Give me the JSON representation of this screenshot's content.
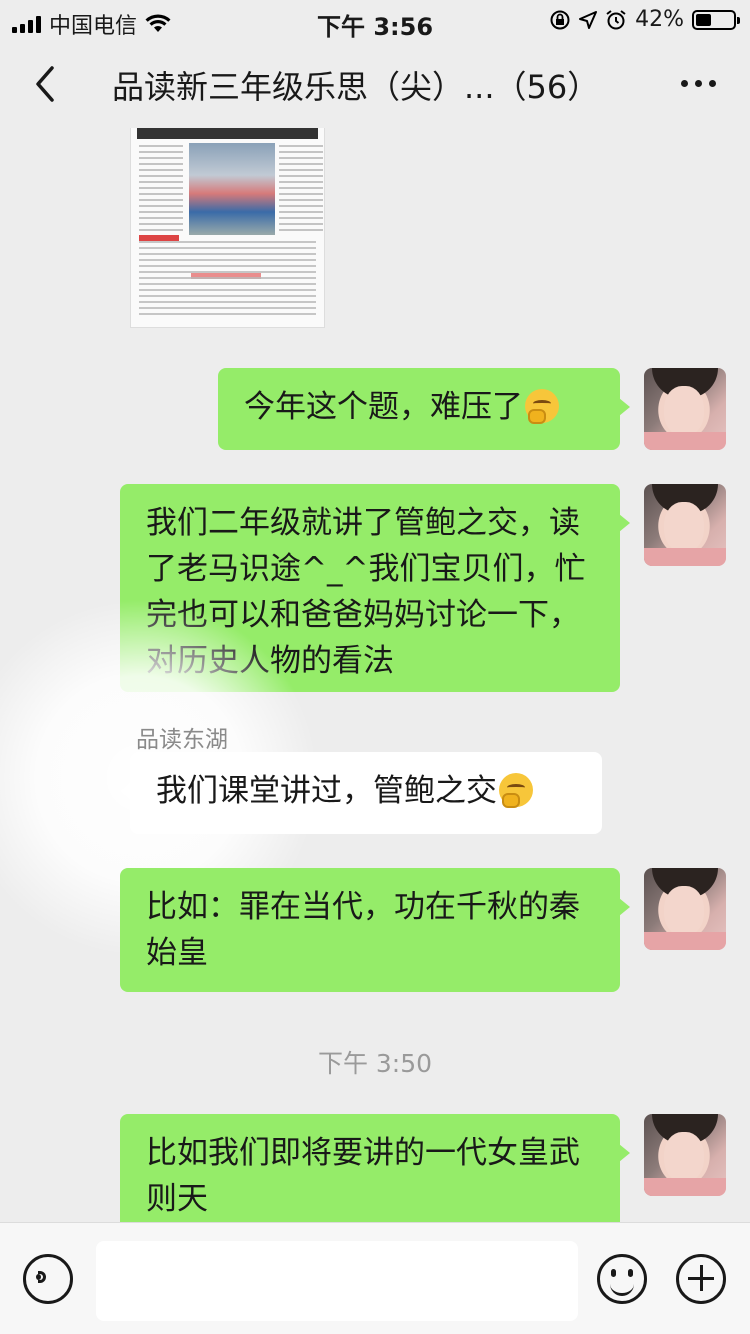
{
  "status_bar": {
    "carrier": "中国电信",
    "time": "下午 3:56",
    "battery_percent": "42%",
    "battery_level": 0.42,
    "icons": [
      "signal-icon",
      "wifi-icon",
      "orientation-lock-icon",
      "location-icon",
      "alarm-icon",
      "battery-icon"
    ]
  },
  "nav": {
    "title": "品读新三年级乐思（尖）...（56）"
  },
  "messages": [
    {
      "side": "right",
      "text": "今年这个题，难压了",
      "emoji": "thinking-emoji"
    },
    {
      "side": "right",
      "text": "我们二年级就讲了管鲍之交，读了老马识途^_^我们宝贝们，忙完也可以和爸爸妈妈讨论一下，对历史人物的看法"
    },
    {
      "side": "left",
      "sender": "品读东湖",
      "text": "我们课堂讲过，管鲍之交",
      "emoji": "thinking-emoji"
    },
    {
      "side": "right",
      "text": "比如：罪在当代，功在千秋的秦始皇"
    },
    {
      "side": "right",
      "text": "比如我们即将要讲的一代女皇武则天"
    }
  ],
  "time_divider": "下午 3:50",
  "input_bar": {
    "icons": [
      "voice-icon",
      "emoji-icon",
      "plus-icon"
    ],
    "placeholder": ""
  }
}
